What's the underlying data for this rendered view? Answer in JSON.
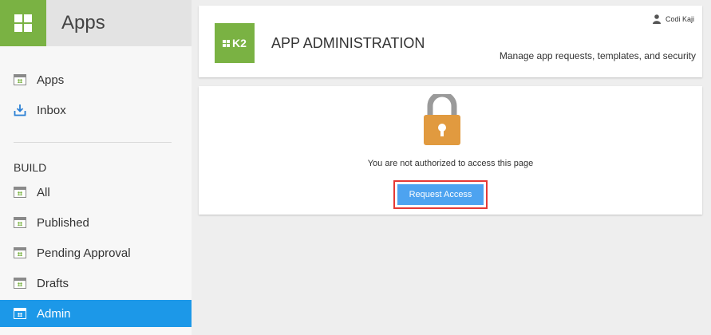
{
  "sidebar": {
    "title": "Apps",
    "items": [
      {
        "label": "Apps",
        "icon": "app-icon"
      },
      {
        "label": "Inbox",
        "icon": "inbox-icon"
      }
    ],
    "build_section": {
      "label": "BUILD",
      "items": [
        {
          "label": "All",
          "icon": "app-icon"
        },
        {
          "label": "Published",
          "icon": "app-icon"
        },
        {
          "label": "Pending Approval",
          "icon": "app-icon"
        },
        {
          "label": "Drafts",
          "icon": "app-icon"
        },
        {
          "label": "Admin",
          "icon": "app-icon",
          "active": true
        }
      ]
    }
  },
  "header": {
    "logo_text": "K2",
    "title": "APP ADMINISTRATION",
    "user_name": "Codi Kaji",
    "subtitle": "Manage app requests, templates, and security"
  },
  "content": {
    "message": "You are not authorized to access this page",
    "request_button": "Request Access"
  },
  "colors": {
    "brand_green": "#7ab243",
    "active_blue": "#1c98e8",
    "button_blue": "#4da3f0",
    "highlight_red": "#e53935",
    "lock_orange": "#e19a3f"
  }
}
